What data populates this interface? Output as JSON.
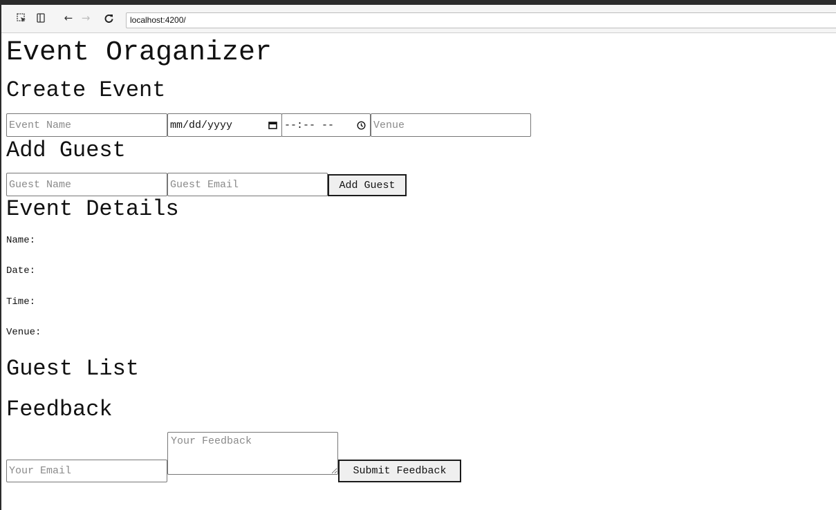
{
  "browser": {
    "url": "localhost:4200/"
  },
  "page": {
    "title": "Event Oraganizer"
  },
  "create_event": {
    "heading": "Create Event",
    "event_name_placeholder": "Event Name",
    "date_display": "mm/dd/yyyy",
    "time_display": "--:-- --",
    "venue_placeholder": "Venue"
  },
  "add_guest": {
    "heading": "Add Guest",
    "guest_name_placeholder": "Guest Name",
    "guest_email_placeholder": "Guest Email",
    "button_label": "Add Guest"
  },
  "event_details": {
    "heading": "Event Details",
    "name_label": "Name:",
    "date_label": "Date:",
    "time_label": "Time:",
    "venue_label": "Venue:"
  },
  "guest_list": {
    "heading": "Guest List"
  },
  "feedback": {
    "heading": "Feedback",
    "email_placeholder": "Your Email",
    "feedback_placeholder": "Your Feedback",
    "button_label": "Submit Feedback"
  },
  "icons": {
    "inspect": "inspect-element-icon",
    "device": "device-toolbar-icon",
    "back": "back-arrow-icon",
    "forward": "forward-arrow-icon",
    "reload": "reload-icon",
    "calendar": "calendar-icon",
    "clock": "clock-icon"
  }
}
